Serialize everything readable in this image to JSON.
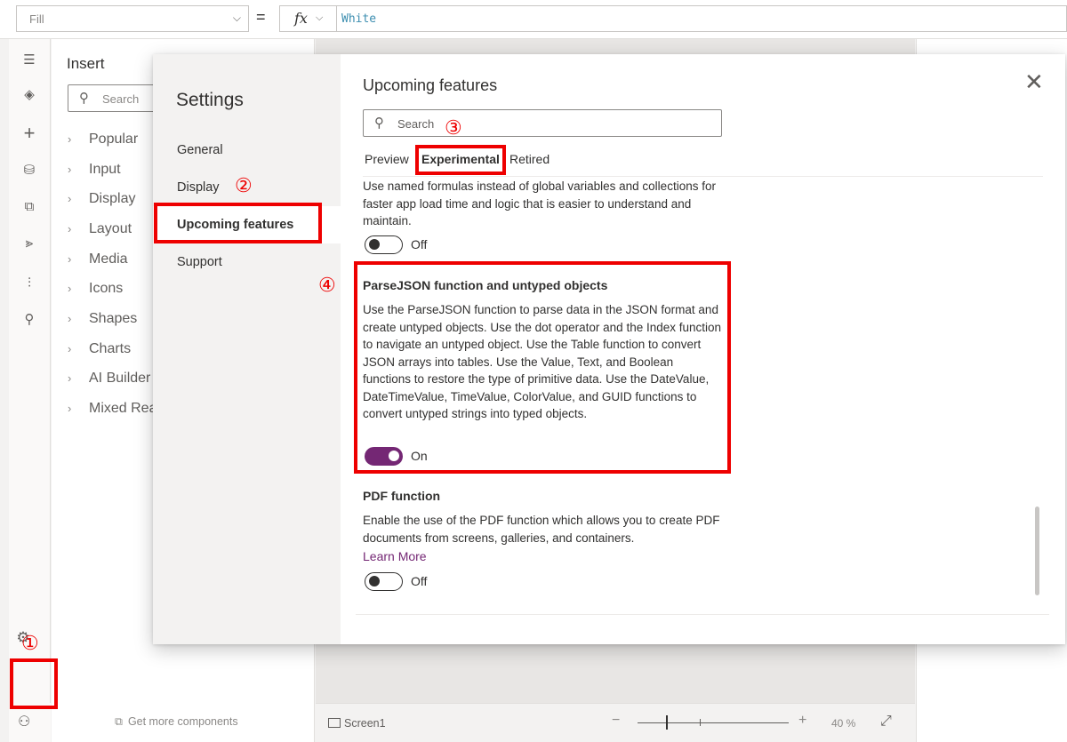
{
  "formula_bar": {
    "property": "Fill",
    "fx_label": "fx",
    "equals": "=",
    "formula": "White"
  },
  "left_rail": {
    "icons": [
      "hamburger-icon",
      "layers-icon",
      "plus-icon",
      "database-icon",
      "media-icon",
      "power-automate-icon",
      "variables-icon",
      "search-icon"
    ],
    "settings_icon": "gear-icon",
    "profile_icon": "person-icon"
  },
  "insert_panel": {
    "title": "Insert",
    "search_placeholder": "Search",
    "categories": [
      "Popular",
      "Input",
      "Display",
      "Layout",
      "Media",
      "Icons",
      "Shapes",
      "Charts",
      "AI Builder",
      "Mixed Reality"
    ],
    "get_more": "Get more components"
  },
  "status_bar": {
    "screen_label": "Screen1",
    "zoom_minus": "−",
    "zoom_plus": "+",
    "zoom_value": "40 %"
  },
  "settings_dialog": {
    "nav_title": "Settings",
    "nav_items": [
      "General",
      "Display",
      "Upcoming features",
      "Support"
    ],
    "active_nav": "Upcoming features",
    "title": "Upcoming features",
    "close_glyph": "✕",
    "search_placeholder": "Search",
    "tabs": [
      "Preview",
      "Experimental",
      "Retired"
    ],
    "active_tab": "Experimental",
    "features": [
      {
        "title": "",
        "description": "Use named formulas instead of global variables and collections for faster app load time and logic that is easier to understand and maintain.",
        "toggle_label": "Off",
        "enabled": false
      },
      {
        "title": "ParseJSON function and untyped objects",
        "description": "Use the ParseJSON function to parse data in the JSON format and create untyped objects. Use the dot operator and the Index function to navigate an untyped object. Use the Table function to convert JSON arrays into tables. Use the Value, Text, and Boolean functions to restore the type of primitive data. Use the DateValue, DateTimeValue, TimeValue, ColorValue, and GUID functions to convert untyped strings into typed objects.",
        "toggle_label": "On",
        "enabled": true
      },
      {
        "title": "PDF function",
        "description": "Enable the use of the PDF function which allows you to create PDF documents from screens, galleries, and containers.",
        "link": "Learn More",
        "toggle_label": "Off",
        "enabled": false
      }
    ]
  },
  "annotations": {
    "step1": "①",
    "step2": "②",
    "step3": "③",
    "step4": "④"
  },
  "colors": {
    "accent": "#742774",
    "annotation_red": "#ee0000",
    "formula_text": "#3d8eb0"
  }
}
